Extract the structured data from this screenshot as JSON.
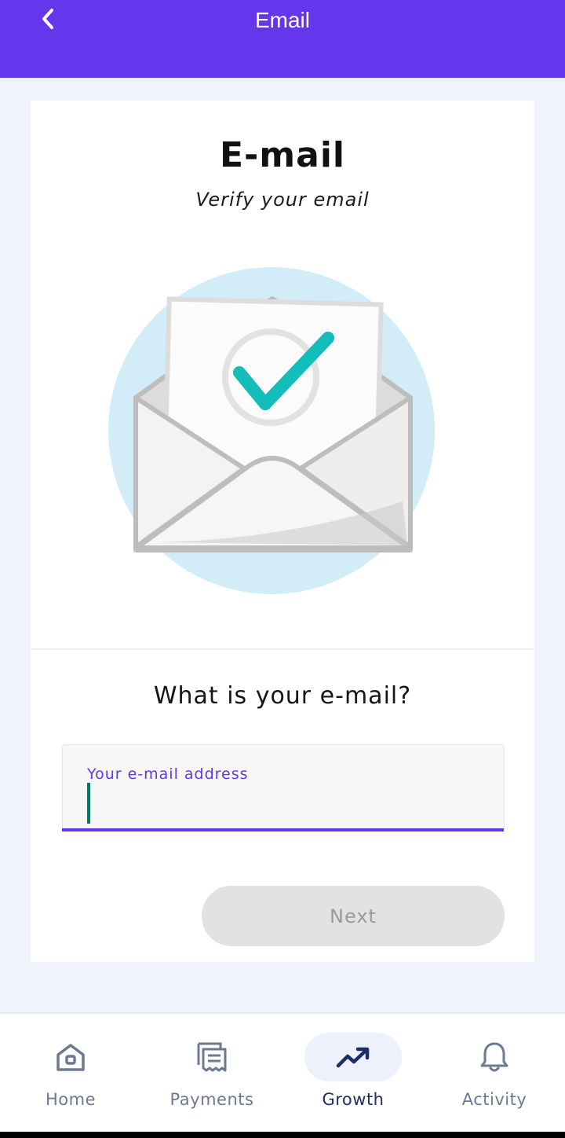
{
  "appbar": {
    "title": "Email",
    "back_icon": "chevron-left-icon",
    "background": "#6536ec"
  },
  "card": {
    "title": "E-mail",
    "subtitle": "Verify your email",
    "illustration": "open-envelope-with-checkmark",
    "question": "What is your e-mail?",
    "email_field": {
      "label": "Your e-mail address",
      "value": "",
      "accent": "#6536ec"
    },
    "next_button": {
      "label": "Next",
      "enabled": false
    }
  },
  "bottom_nav": {
    "items": [
      {
        "label": "Home",
        "icon": "home-icon",
        "active": false
      },
      {
        "label": "Payments",
        "icon": "receipt-icon",
        "active": false
      },
      {
        "label": "Growth",
        "icon": "trending-up-icon",
        "active": true
      },
      {
        "label": "Activity",
        "icon": "bell-icon",
        "active": false
      }
    ]
  },
  "colors": {
    "primary": "#6536ec",
    "check": "#13bdb9",
    "nav_active": "#1d2d6b",
    "nav_inactive": "#6e7890"
  }
}
